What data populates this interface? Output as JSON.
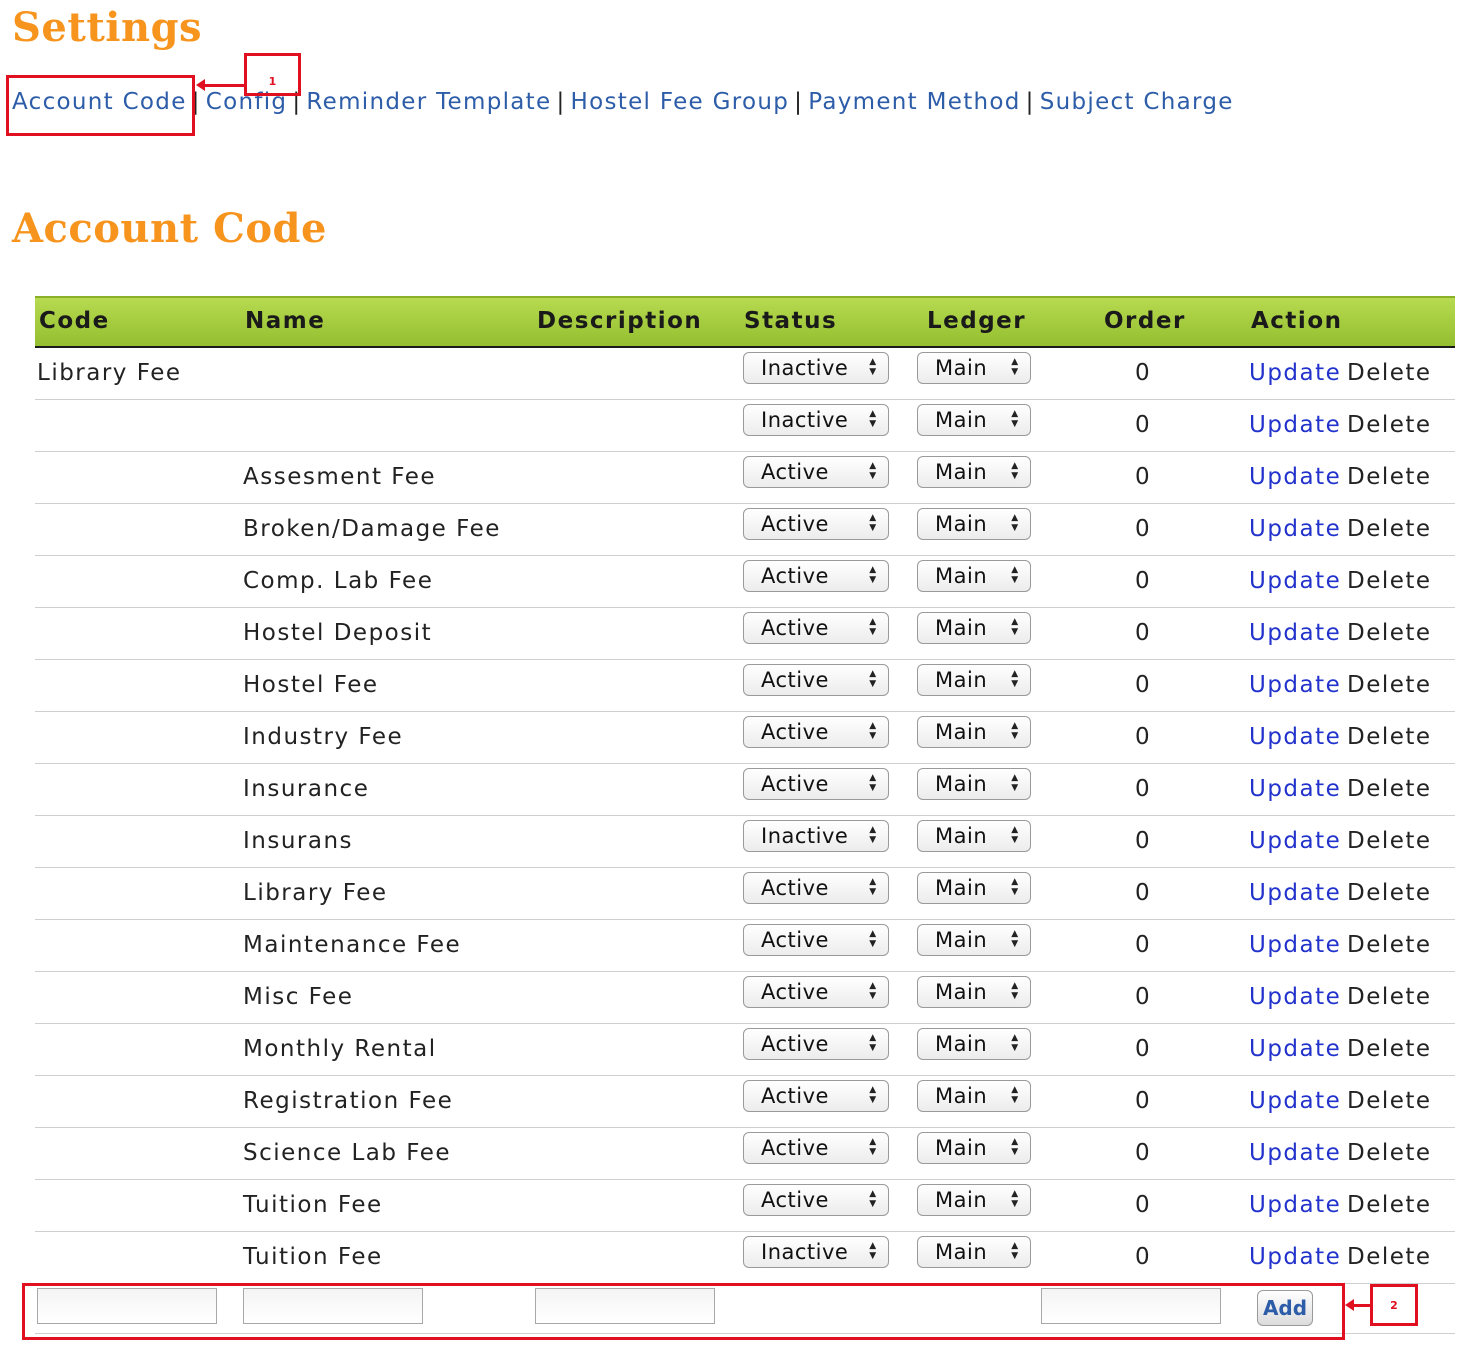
{
  "page": {
    "title": "Settings",
    "nav": [
      "Account Code",
      "Config",
      "Reminder Template",
      "Hostel Fee Group",
      "Payment Method",
      "Subject Charge"
    ],
    "nav_separator": "|",
    "section_title": "Account Code"
  },
  "table": {
    "columns": [
      "Code",
      "Name",
      "Description",
      "Status",
      "Ledger",
      "Order",
      "Action"
    ],
    "rows": [
      {
        "code": "Library Fee",
        "name": "",
        "description": "",
        "status": "Inactive",
        "ledger": "Main",
        "order": "0",
        "update": "Update",
        "delete": "Delete"
      },
      {
        "code": "",
        "name": "",
        "description": "",
        "status": "Inactive",
        "ledger": "Main",
        "order": "0",
        "update": "Update",
        "delete": "Delete"
      },
      {
        "code": "",
        "name": "Assesment Fee",
        "description": "",
        "status": "Active",
        "ledger": "Main",
        "order": "0",
        "update": "Update",
        "delete": "Delete"
      },
      {
        "code": "",
        "name": "Broken/Damage Fee",
        "description": "",
        "status": "Active",
        "ledger": "Main",
        "order": "0",
        "update": "Update",
        "delete": "Delete"
      },
      {
        "code": "",
        "name": "Comp. Lab Fee",
        "description": "",
        "status": "Active",
        "ledger": "Main",
        "order": "0",
        "update": "Update",
        "delete": "Delete"
      },
      {
        "code": "",
        "name": "Hostel Deposit",
        "description": "",
        "status": "Active",
        "ledger": "Main",
        "order": "0",
        "update": "Update",
        "delete": "Delete"
      },
      {
        "code": "",
        "name": "Hostel Fee",
        "description": "",
        "status": "Active",
        "ledger": "Main",
        "order": "0",
        "update": "Update",
        "delete": "Delete"
      },
      {
        "code": "",
        "name": "Industry Fee",
        "description": "",
        "status": "Active",
        "ledger": "Main",
        "order": "0",
        "update": "Update",
        "delete": "Delete"
      },
      {
        "code": "",
        "name": "Insurance",
        "description": "",
        "status": "Active",
        "ledger": "Main",
        "order": "0",
        "update": "Update",
        "delete": "Delete"
      },
      {
        "code": "",
        "name": "Insurans",
        "description": "",
        "status": "Inactive",
        "ledger": "Main",
        "order": "0",
        "update": "Update",
        "delete": "Delete"
      },
      {
        "code": "",
        "name": "Library Fee",
        "description": "",
        "status": "Active",
        "ledger": "Main",
        "order": "0",
        "update": "Update",
        "delete": "Delete"
      },
      {
        "code": "",
        "name": "Maintenance Fee",
        "description": "",
        "status": "Active",
        "ledger": "Main",
        "order": "0",
        "update": "Update",
        "delete": "Delete"
      },
      {
        "code": "",
        "name": "Misc Fee",
        "description": "",
        "status": "Active",
        "ledger": "Main",
        "order": "0",
        "update": "Update",
        "delete": "Delete"
      },
      {
        "code": "",
        "name": "Monthly Rental",
        "description": "",
        "status": "Active",
        "ledger": "Main",
        "order": "0",
        "update": "Update",
        "delete": "Delete"
      },
      {
        "code": "",
        "name": "Registration Fee",
        "description": "",
        "status": "Active",
        "ledger": "Main",
        "order": "0",
        "update": "Update",
        "delete": "Delete"
      },
      {
        "code": "",
        "name": "Science Lab Fee",
        "description": "",
        "status": "Active",
        "ledger": "Main",
        "order": "0",
        "update": "Update",
        "delete": "Delete"
      },
      {
        "code": "",
        "name": "Tuition Fee",
        "description": "",
        "status": "Active",
        "ledger": "Main",
        "order": "0",
        "update": "Update",
        "delete": "Delete"
      },
      {
        "code": "",
        "name": "Tuition Fee",
        "description": "",
        "status": "Inactive",
        "ledger": "Main",
        "order": "0",
        "update": "Update",
        "delete": "Delete"
      }
    ],
    "add_row": {
      "code_value": "",
      "name_value": "",
      "description_value": "",
      "order_value": "",
      "add_label": "Add"
    }
  },
  "callouts": {
    "one": "1",
    "two": "2"
  },
  "colors": {
    "title": "#f7941d",
    "link": "#2d5da8",
    "update_link": "#2233cc",
    "header_green": "#a5cc3f",
    "callout_red": "#e01020"
  }
}
